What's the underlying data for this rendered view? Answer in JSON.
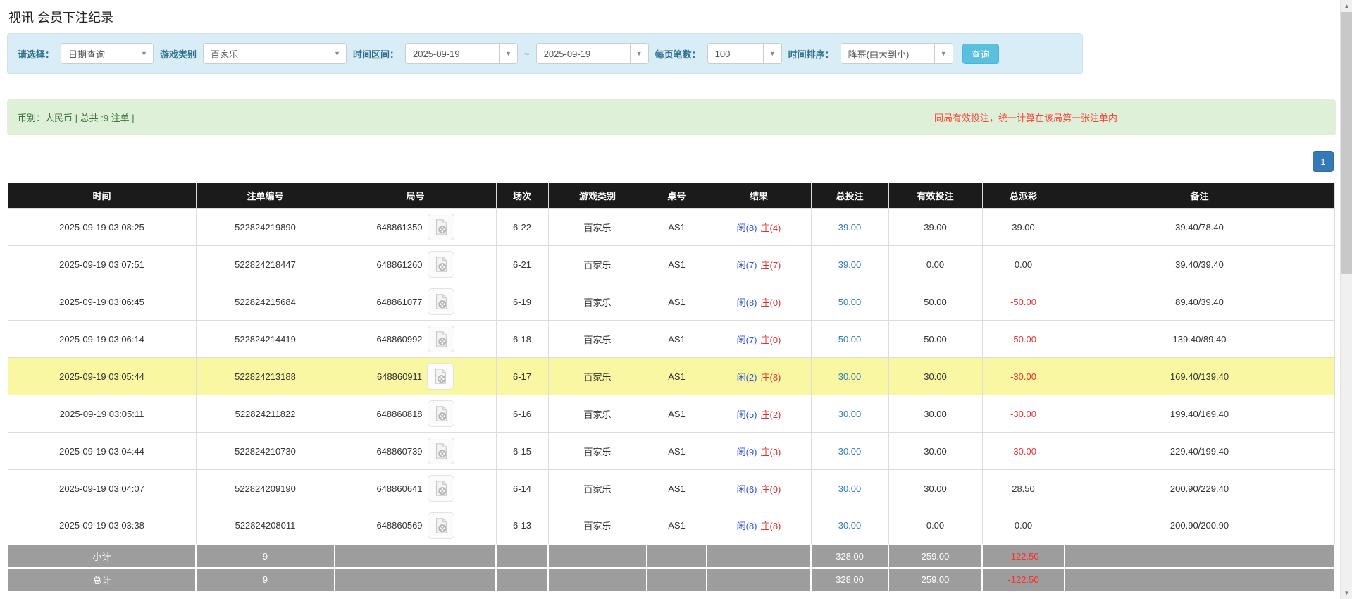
{
  "page": {
    "title": "视讯 会员下注纪录"
  },
  "filters": {
    "select_label": "请选择：",
    "select_value": "日期查询",
    "game_type_label": "游戏类别",
    "game_type_value": "百家乐",
    "time_range_label": "时间区间：",
    "date_from": "2025-09-19",
    "tilde": "~",
    "date_to": "2025-09-19",
    "page_size_label": "每页笔数：",
    "page_size_value": "100",
    "sort_label": "时间排序：",
    "sort_value": "降幂(由大到小)",
    "search_button": "查询"
  },
  "summary": {
    "left_text": "币别：人民币 | 总共 :9 注单 |",
    "right_notice": "同局有效投注，统一计算在该局第一张注单内"
  },
  "pagination": {
    "page": "1"
  },
  "colors": {
    "header_bg": "#1b1b1b",
    "highlight_row": "#faf7a2",
    "totals_bg": "#9d9d9d",
    "link_blue": "#337ab7",
    "player_blue": "#3355cc",
    "banker_red": "#d63333",
    "negative_red": "#e83333",
    "search_button_bg": "#5bc0de",
    "panel_bg": "#d9edf7",
    "summary_bg": "#dff0d8",
    "notice_red": "#f8433a"
  },
  "table": {
    "headers": [
      "时间",
      "注单编号",
      "局号",
      "场次",
      "游戏类别",
      "桌号",
      "结果",
      "总投注",
      "有效投注",
      "总派彩",
      "备注"
    ],
    "rows": [
      {
        "time": "2025-09-19 03:08:25",
        "bet_id": "522824219890",
        "round_id": "648861350",
        "session": "6-22",
        "game": "百家乐",
        "table_no": "AS1",
        "result_player": "闲(8)",
        "result_banker": "庄(4)",
        "total_bet": "39.00",
        "valid_bet": "39.00",
        "payout": "39.00",
        "note": "39.40/78.40",
        "highlight": false
      },
      {
        "time": "2025-09-19 03:07:51",
        "bet_id": "522824218447",
        "round_id": "648861260",
        "session": "6-21",
        "game": "百家乐",
        "table_no": "AS1",
        "result_player": "闲(7)",
        "result_banker": "庄(7)",
        "total_bet": "39.00",
        "valid_bet": "0.00",
        "payout": "0.00",
        "note": "39.40/39.40",
        "highlight": false
      },
      {
        "time": "2025-09-19 03:06:45",
        "bet_id": "522824215684",
        "round_id": "648861077",
        "session": "6-19",
        "game": "百家乐",
        "table_no": "AS1",
        "result_player": "闲(8)",
        "result_banker": "庄(0)",
        "total_bet": "50.00",
        "valid_bet": "50.00",
        "payout": "-50.00",
        "note": "89.40/39.40",
        "highlight": false
      },
      {
        "time": "2025-09-19 03:06:14",
        "bet_id": "522824214419",
        "round_id": "648860992",
        "session": "6-18",
        "game": "百家乐",
        "table_no": "AS1",
        "result_player": "闲(7)",
        "result_banker": "庄(0)",
        "total_bet": "50.00",
        "valid_bet": "50.00",
        "payout": "-50.00",
        "note": "139.40/89.40",
        "highlight": false
      },
      {
        "time": "2025-09-19 03:05:44",
        "bet_id": "522824213188",
        "round_id": "648860911",
        "session": "6-17",
        "game": "百家乐",
        "table_no": "AS1",
        "result_player": "闲(2)",
        "result_banker": "庄(8)",
        "total_bet": "30.00",
        "valid_bet": "30.00",
        "payout": "-30.00",
        "note": "169.40/139.40",
        "highlight": true
      },
      {
        "time": "2025-09-19 03:05:11",
        "bet_id": "522824211822",
        "round_id": "648860818",
        "session": "6-16",
        "game": "百家乐",
        "table_no": "AS1",
        "result_player": "闲(5)",
        "result_banker": "庄(2)",
        "total_bet": "30.00",
        "valid_bet": "30.00",
        "payout": "-30.00",
        "note": "199.40/169.40",
        "highlight": false
      },
      {
        "time": "2025-09-19 03:04:44",
        "bet_id": "522824210730",
        "round_id": "648860739",
        "session": "6-15",
        "game": "百家乐",
        "table_no": "AS1",
        "result_player": "闲(9)",
        "result_banker": "庄(3)",
        "total_bet": "30.00",
        "valid_bet": "30.00",
        "payout": "-30.00",
        "note": "229.40/199.40",
        "highlight": false
      },
      {
        "time": "2025-09-19 03:04:07",
        "bet_id": "522824209190",
        "round_id": "648860641",
        "session": "6-14",
        "game": "百家乐",
        "table_no": "AS1",
        "result_player": "闲(6)",
        "result_banker": "庄(9)",
        "total_bet": "30.00",
        "valid_bet": "30.00",
        "payout": "28.50",
        "note": "200.90/229.40",
        "highlight": false
      },
      {
        "time": "2025-09-19 03:03:38",
        "bet_id": "522824208011",
        "round_id": "648860569",
        "session": "6-13",
        "game": "百家乐",
        "table_no": "AS1",
        "result_player": "闲(8)",
        "result_banker": "庄(8)",
        "total_bet": "30.00",
        "valid_bet": "0.00",
        "payout": "0.00",
        "note": "200.90/200.90",
        "highlight": false
      }
    ],
    "subtotal": {
      "label": "小计",
      "count": "9",
      "total_bet": "328.00",
      "valid_bet": "259.00",
      "payout": "-122.50"
    },
    "total": {
      "label": "总计",
      "count": "9",
      "total_bet": "328.00",
      "valid_bet": "259.00",
      "payout": "-122.50"
    }
  }
}
